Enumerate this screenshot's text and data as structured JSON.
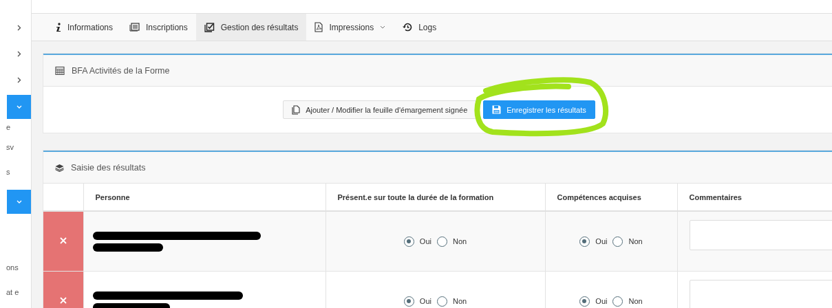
{
  "sidebar": {
    "items": [
      {
        "kind": "chevron",
        "active": false
      },
      {
        "kind": "chevron",
        "active": false
      },
      {
        "kind": "chevron",
        "active": false
      },
      {
        "kind": "chevron",
        "active": true
      },
      {
        "kind": "text",
        "label": "e"
      },
      {
        "kind": "text",
        "label": "sv"
      },
      {
        "kind": "text",
        "label": "s"
      },
      {
        "kind": "chevron",
        "active": true
      },
      {
        "kind": "text",
        "label": "ons"
      },
      {
        "kind": "text",
        "label": "at e"
      }
    ]
  },
  "tabs": [
    {
      "label": "Informations",
      "selected": false,
      "dropdown": false
    },
    {
      "label": "Inscriptions",
      "selected": false,
      "dropdown": false
    },
    {
      "label": "Gestion des résultats",
      "selected": true,
      "dropdown": false
    },
    {
      "label": "Impressions",
      "selected": false,
      "dropdown": true
    },
    {
      "label": "Logs",
      "selected": false,
      "dropdown": false
    }
  ],
  "session_card": {
    "title": "BFA Activités de la Forme",
    "buttons": [
      {
        "label": "Ajouter / Modifier la feuille d'émargement signée",
        "kind": "default",
        "highlighted": false
      },
      {
        "label": "Enregistrer les résultats",
        "kind": "primary",
        "highlighted": true
      }
    ]
  },
  "results_card": {
    "title": "Saisie des résultats",
    "table": {
      "columns": [
        "Personne",
        "Présent.e sur toute la durée de la formation",
        "Compétences acquises",
        "Commentaires"
      ],
      "rows": [
        {
          "presence": [
            {
              "label": "Oui",
              "selected": true
            },
            {
              "label": "Non",
              "selected": false
            }
          ],
          "competences": [
            {
              "label": "Oui",
              "selected": true
            },
            {
              "label": "Non",
              "selected": false
            }
          ]
        },
        {
          "presence": [
            {
              "label": "Oui",
              "selected": true
            },
            {
              "label": "Non",
              "selected": false
            }
          ],
          "competences": [
            {
              "label": "Oui",
              "selected": true
            },
            {
              "label": "Non",
              "selected": false
            }
          ]
        }
      ]
    }
  }
}
